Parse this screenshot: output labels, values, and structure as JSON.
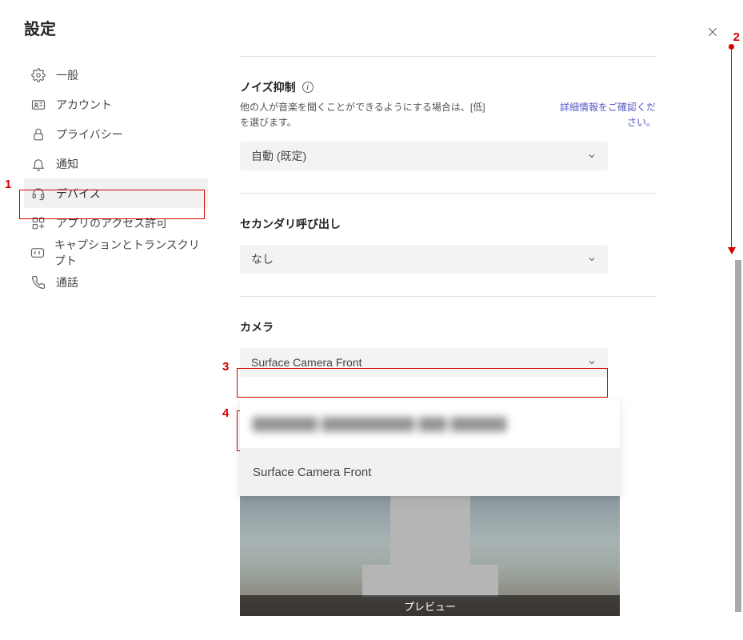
{
  "title": "設定",
  "sidebar": {
    "items": [
      {
        "label": "一般",
        "id": "general"
      },
      {
        "label": "アカウント",
        "id": "account"
      },
      {
        "label": "プライバシー",
        "id": "privacy"
      },
      {
        "label": "通知",
        "id": "notifications"
      },
      {
        "label": "デバイス",
        "id": "devices"
      },
      {
        "label": "アプリのアクセス許可",
        "id": "app-permissions"
      },
      {
        "label": "キャプションとトランスクリプト",
        "id": "captions"
      },
      {
        "label": "通話",
        "id": "calls"
      }
    ],
    "active_index": 4
  },
  "sections": {
    "noise": {
      "title": "ノイズ抑制",
      "desc": "他の人が音楽を聞くことができるようにする場合は、[低] を選びます。",
      "link": "詳細情報をご確認ください。",
      "value": "自動 (既定)"
    },
    "secondary": {
      "title": "セカンダリ呼び出し",
      "value": "なし"
    },
    "camera": {
      "title": "カメラ",
      "value": "Surface Camera Front",
      "options": [
        {
          "label": "███████ ██████████ ███ ██████",
          "blurred": true
        },
        {
          "label": "Surface Camera Front",
          "blurred": false,
          "selected": true
        }
      ],
      "preview_label": "プレビュー"
    }
  },
  "annotations": {
    "n1": "1",
    "n2": "2",
    "n3": "3",
    "n4": "4"
  }
}
